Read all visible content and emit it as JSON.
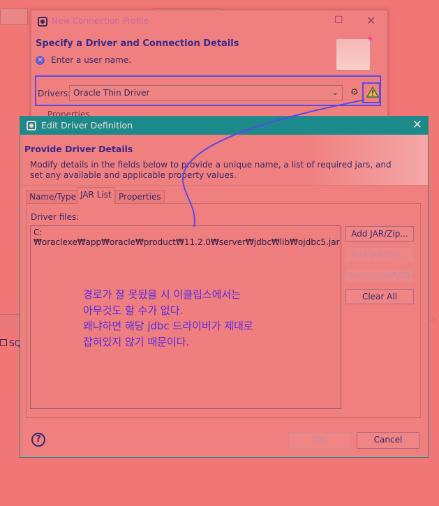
{
  "parent_window": {
    "title": "New Connection Profile",
    "section_title": "Specify a Driver and Connection Details",
    "error_message": "Enter a user name.",
    "drivers_label": "Drivers:",
    "drivers_value": "Oracle Thin Driver",
    "properties_label": "Properties"
  },
  "side_panel": {
    "label": "SQ"
  },
  "dialog": {
    "title": "Edit Driver Definition",
    "header_title": "Provide Driver Details",
    "header_desc": "Modify details in the fields below to provide a unique name, a list of required jars, and set any available and applicable property values.",
    "tabs": [
      {
        "label": "Name/Type"
      },
      {
        "label": "JAR List"
      },
      {
        "label": "Properties"
      }
    ],
    "files_label": "Driver files:",
    "files": [
      "C:₩oraclexe₩app₩oracle₩product₩11.2.0₩server₩jdbc₩lib₩ojdbc5.jar"
    ],
    "buttons": {
      "add": "Add JAR/Zip...",
      "edit": "Edit JAR/Zip...",
      "remove": "Remove JAR/Zip",
      "clear": "Clear All",
      "ok": "OK",
      "cancel": "Cancel"
    },
    "annotation": [
      "경로가 잘 못됬을 시 이클립스에서는",
      "아무것도 할 수가 없다.",
      "왜냐하면 해당 jdbc 드라이버가 제대로",
      "잡혀있지 않기 때문이다."
    ]
  },
  "colors": {
    "background": "#f17777",
    "dialog_titlebar": "#1c8a8a",
    "annotation": "#5a2ae6",
    "heading": "#3a2a8a"
  }
}
